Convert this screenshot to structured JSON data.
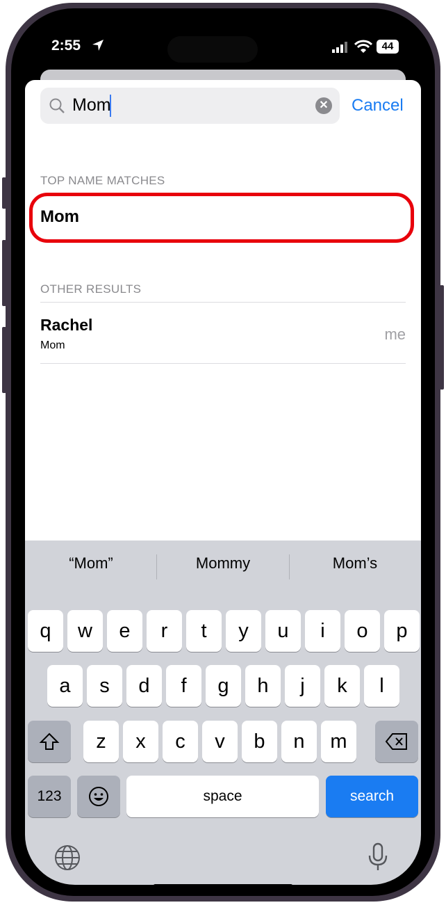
{
  "status": {
    "time": "2:55",
    "battery": "44"
  },
  "search": {
    "value": "Mom",
    "cancel": "Cancel"
  },
  "sections": {
    "top": "TOP NAME MATCHES",
    "other": "OTHER RESULTS"
  },
  "top_match": {
    "name": "Mom"
  },
  "other_results": [
    {
      "name": "Rachel",
      "subtitle": "Mom",
      "tag": "me"
    }
  ],
  "highlight_color": "#e8000b",
  "accent": "#1a7cf2",
  "keyboard": {
    "suggestions": [
      "“Mom”",
      "Mommy",
      "Mom’s"
    ],
    "row1": [
      "q",
      "w",
      "e",
      "r",
      "t",
      "y",
      "u",
      "i",
      "o",
      "p"
    ],
    "row2": [
      "a",
      "s",
      "d",
      "f",
      "g",
      "h",
      "j",
      "k",
      "l"
    ],
    "row3": [
      "z",
      "x",
      "c",
      "v",
      "b",
      "n",
      "m"
    ],
    "numbers": "123",
    "space": "space",
    "search": "search"
  }
}
